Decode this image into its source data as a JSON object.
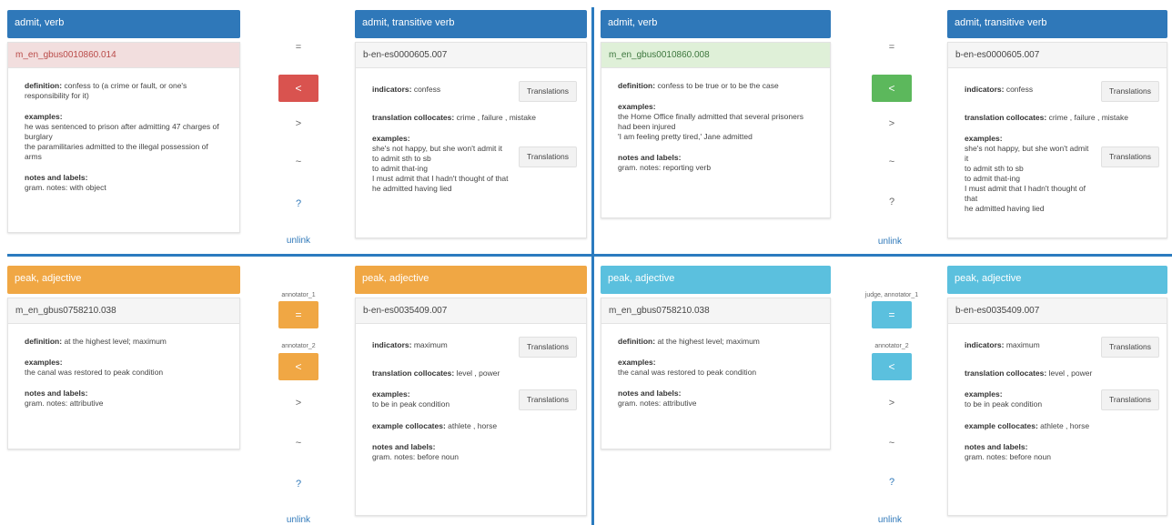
{
  "q1": {
    "left_header": "admit, verb",
    "right_header": "admit, transitive verb",
    "left_id": "m_en_gbus0010860.014",
    "right_id": "b-en-es0000605.007",
    "left": {
      "definition_label": "definition:",
      "definition": "confess to (a crime or fault, or one's responsibility for it)",
      "examples_label": "examples:",
      "examples": [
        "he was sentenced to prison after admitting 47 charges of burglary",
        "the paramilitaries admitted to the illegal possession of arms"
      ],
      "notes_label": "notes and labels:",
      "notes": "gram. notes: with object"
    },
    "right": {
      "indicators_label": "indicators:",
      "indicators": "confess",
      "collocates_label": "translation collocates:",
      "collocates": "crime , failure , mistake",
      "examples_label": "examples:",
      "examples": [
        "she's not happy, but she won't admit it",
        "to admit sth to sb",
        "to admit that-ing",
        "I must admit that I hadn't thought of that",
        "he admitted having lied"
      ],
      "translations_btn": "Translations"
    },
    "controls": {
      "eq": "=",
      "lt": "<",
      "gt": ">",
      "tilde": "~",
      "q": "?",
      "unlink": "unlink"
    }
  },
  "q2": {
    "left_header": "admit, verb",
    "right_header": "admit, transitive verb",
    "left_id": "m_en_gbus0010860.008",
    "right_id": "b-en-es0000605.007",
    "left": {
      "definition_label": "definition:",
      "definition": "confess to be true or to be the case",
      "examples_label": "examples:",
      "examples": [
        "the Home Office finally admitted that several prisoners had been injured",
        "'I am feeling pretty tired,' Jane admitted"
      ],
      "notes_label": "notes and labels:",
      "notes": "gram. notes: reporting verb"
    },
    "right": {
      "indicators_label": "indicators:",
      "indicators": "confess",
      "collocates_label": "translation collocates:",
      "collocates": "crime , failure , mistake",
      "examples_label": "examples:",
      "examples": [
        "she's not happy, but she won't admit it",
        "to admit sth to sb",
        "to admit that-ing",
        "I must admit that I hadn't thought of that",
        "he admitted having lied"
      ],
      "translations_btn": "Translations"
    },
    "controls": {
      "eq": "=",
      "lt": "<",
      "gt": ">",
      "tilde": "~",
      "q": "?",
      "unlink": "unlink"
    }
  },
  "q3": {
    "left_header": "peak, adjective",
    "right_header": "peak, adjective",
    "left_id": "m_en_gbus0758210.038",
    "right_id": "b-en-es0035409.007",
    "left": {
      "definition_label": "definition:",
      "definition": "at the highest level; maximum",
      "examples_label": "examples:",
      "examples": [
        "the canal was restored to peak condition"
      ],
      "notes_label": "notes and labels:",
      "notes": "gram. notes: attributive"
    },
    "right": {
      "indicators_label": "indicators:",
      "indicators": "maximum",
      "collocates_label": "translation collocates:",
      "collocates": "level , power",
      "examples_label": "examples:",
      "examples": [
        "to be in peak condition"
      ],
      "ex_collocates_label": "example collocates:",
      "ex_collocates": "athlete , horse",
      "notes_label": "notes and labels:",
      "notes": "gram. notes: before noun",
      "translations_btn": "Translations"
    },
    "controls": {
      "annot1": "annotator_1",
      "annot2": "annotator_2",
      "eq": "=",
      "lt": "<",
      "gt": ">",
      "tilde": "~",
      "q": "?",
      "unlink": "unlink"
    }
  },
  "q4": {
    "left_header": "peak, adjective",
    "right_header": "peak, adjective",
    "left_id": "m_en_gbus0758210.038",
    "right_id": "b-en-es0035409.007",
    "left": {
      "definition_label": "definition:",
      "definition": "at the highest level; maximum",
      "examples_label": "examples:",
      "examples": [
        "the canal was restored to peak condition"
      ],
      "notes_label": "notes and labels:",
      "notes": "gram. notes: attributive"
    },
    "right": {
      "indicators_label": "indicators:",
      "indicators": "maximum",
      "collocates_label": "translation collocates:",
      "collocates": "level , power",
      "examples_label": "examples:",
      "examples": [
        "to be in peak condition"
      ],
      "ex_collocates_label": "example collocates:",
      "ex_collocates": "athlete , horse",
      "notes_label": "notes and labels:",
      "notes": "gram. notes: before noun",
      "translations_btn": "Translations"
    },
    "controls": {
      "annot1": "judge, annotator_1",
      "annot2": "annotator_2",
      "eq": "=",
      "lt": "<",
      "gt": ">",
      "tilde": "~",
      "q": "?",
      "unlink": "unlink"
    }
  }
}
